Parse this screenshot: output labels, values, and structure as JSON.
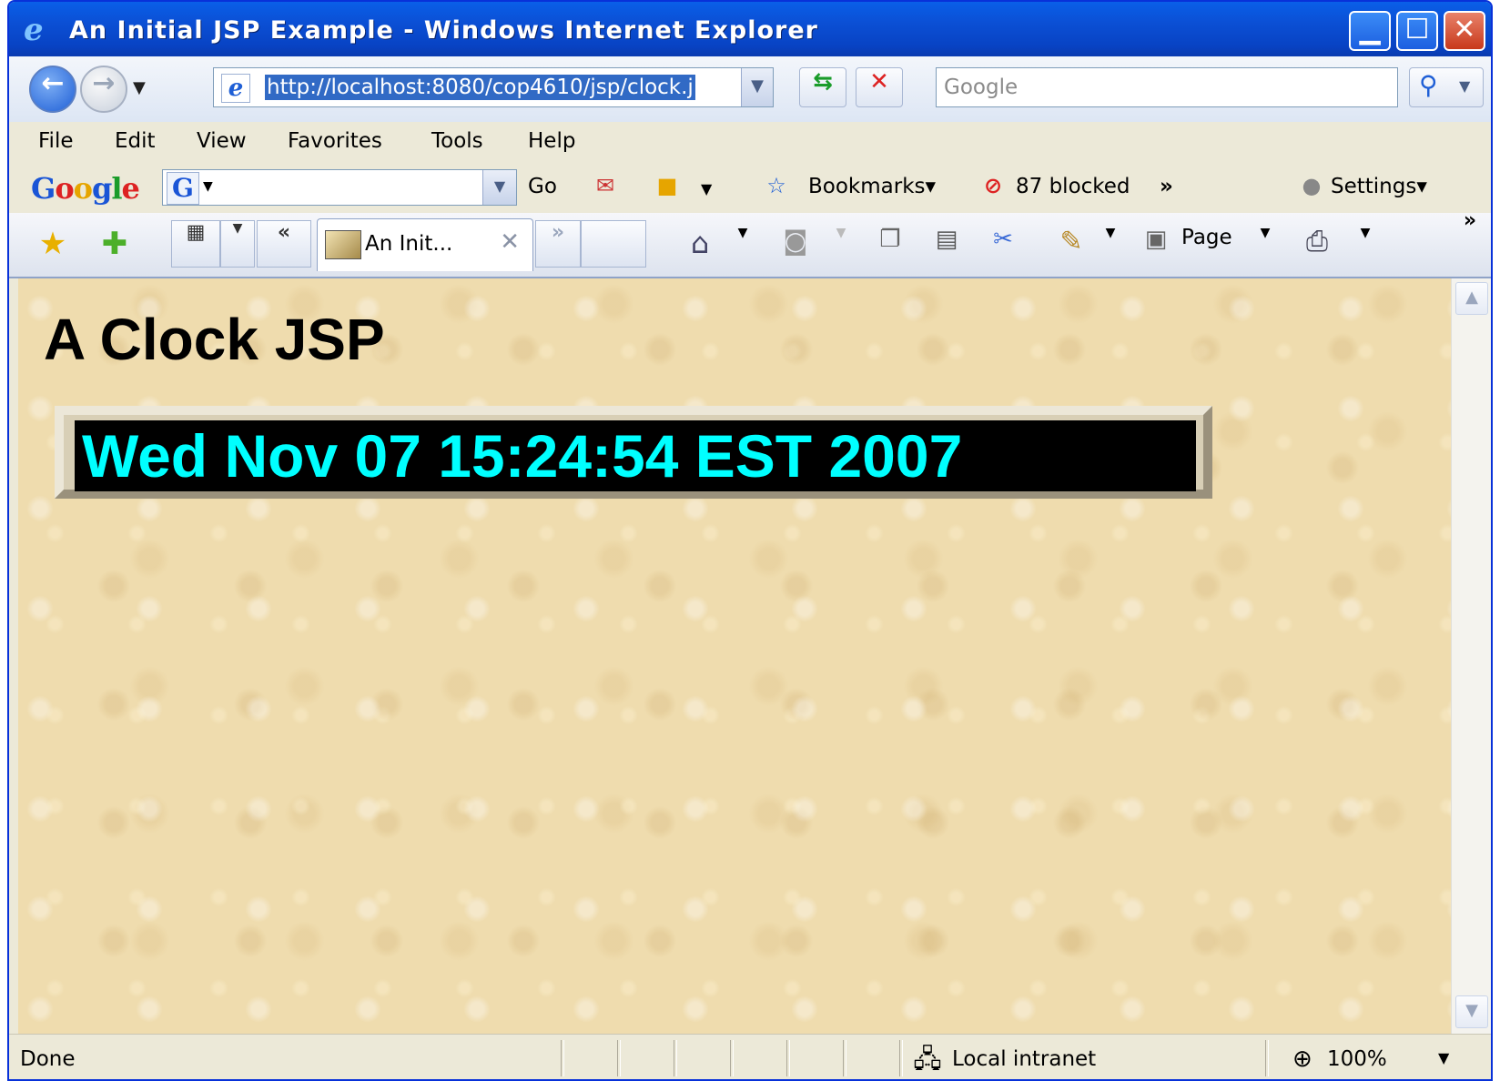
{
  "window": {
    "title": "An Initial JSP Example - Windows Internet Explorer",
    "minimize_glyph": "▁",
    "maximize_glyph": "☐",
    "close_glyph": "✕"
  },
  "address_bar": {
    "url": "http://localhost:8080/cop4610/jsp/clock.j",
    "search_placeholder": "Google"
  },
  "menu": [
    "File",
    "Edit",
    "View",
    "Favorites",
    "Tools",
    "Help"
  ],
  "google_toolbar": {
    "logo_parts": [
      "G",
      "o",
      "o",
      "g",
      "l",
      "e"
    ],
    "g_badge": "G",
    "go_label": "Go",
    "bookmarks_label": "Bookmarks▾",
    "blocked_label": "87 blocked",
    "chevron": "»",
    "settings_label": "Settings▾"
  },
  "tabs": {
    "active_tab_label": "An Init...",
    "nav_prev": "«",
    "nav_next": "»",
    "page_label": "Page",
    "overflow": "»"
  },
  "content": {
    "heading": "A Clock JSP",
    "clock_text": "Wed Nov 07 15:24:54 EST 2007"
  },
  "status": {
    "text": "Done",
    "zone": "Local intranet",
    "zoom": "100%"
  },
  "colors": {
    "clock_fg": "#00ffff",
    "clock_bg": "#000000",
    "page_bg": "#efdcae",
    "titlebar": "#0a5fe8"
  },
  "icons": {
    "back": "back-arrow-icon",
    "forward": "forward-arrow-icon",
    "refresh": "refresh-icon",
    "stop": "stop-icon",
    "search": "search-icon",
    "home": "home-icon",
    "feeds": "feeds-icon",
    "print": "print-icon",
    "favorites": "favorites-star-icon",
    "add_favorite": "add-favorite-icon",
    "zone": "local-intranet-icon",
    "zoom": "zoom-icon"
  }
}
